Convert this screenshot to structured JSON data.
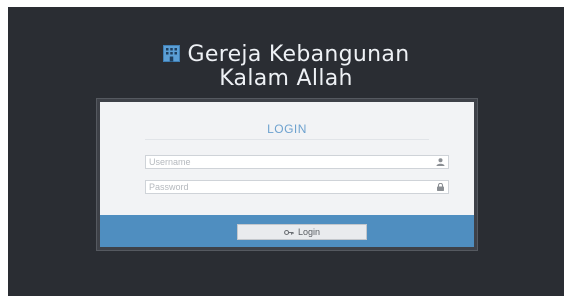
{
  "brand": {
    "line1": "Gereja Kebangunan",
    "line2": "Kalam Allah",
    "icon": "building-icon"
  },
  "login": {
    "title": "LOGIN",
    "username_placeholder": "Username",
    "username_value": "",
    "username_icon": "user-icon",
    "password_placeholder": "Password",
    "password_value": "",
    "password_icon": "lock-icon",
    "button_label": "Login",
    "button_icon": "key-icon"
  },
  "colors": {
    "background": "#2a2d33",
    "accent": "#4f8ec0",
    "title": "#6ea2cf",
    "brand_icon": "#5b9fd6"
  }
}
